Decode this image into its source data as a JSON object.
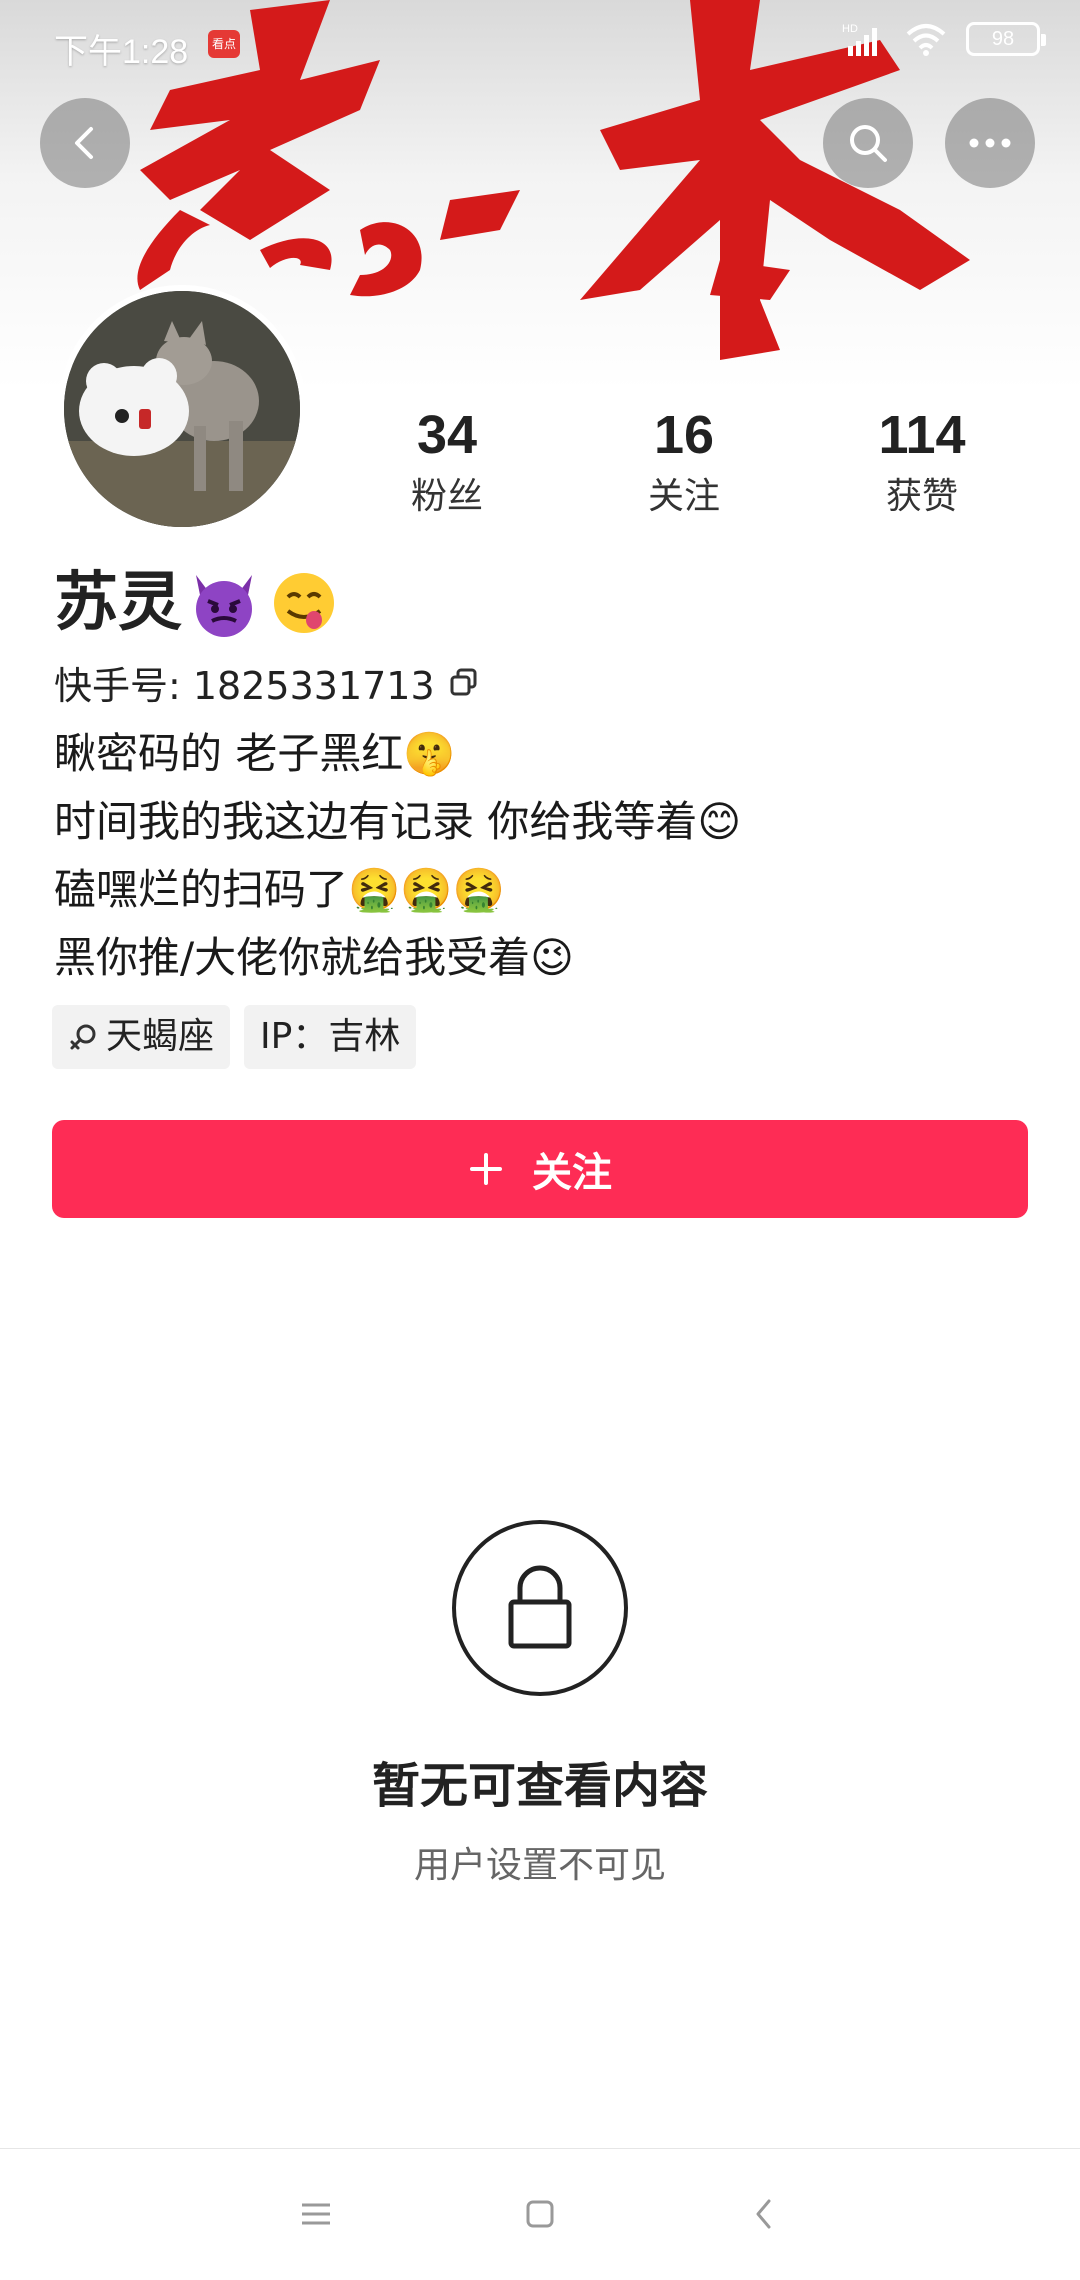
{
  "status_bar": {
    "time": "下午1:28",
    "app_badge": "看点",
    "network": "HD",
    "battery": "98"
  },
  "header": {
    "banner_text": "忘本",
    "back_icon": "chevron-left-icon",
    "search_icon": "search-icon",
    "more_icon": "more-dots-icon"
  },
  "profile": {
    "name": "苏灵",
    "name_emojis": [
      "😈",
      "😋"
    ],
    "id_label": "快手号: 1825331713",
    "stats": [
      {
        "value": "34",
        "label": "粉丝"
      },
      {
        "value": "16",
        "label": "关注"
      },
      {
        "value": "114",
        "label": "获赞"
      }
    ],
    "bio": [
      {
        "text": "瞅密码的 老子黑红",
        "emoji": "🤫"
      },
      {
        "text": "时间我的我这边有记录 你给我等着",
        "emoji": "😊"
      },
      {
        "text": "磕嘿烂的扫码了",
        "emoji": "🤮🤮🤮"
      },
      {
        "text": "黑你推/大佬你就给我受着",
        "emoji": "😉"
      }
    ],
    "tags": [
      {
        "icon": "female-symbol-icon",
        "label": "天蝎座"
      },
      {
        "label": "IP：吉林"
      }
    ],
    "follow_button": "关注"
  },
  "empty_state": {
    "title": "暂无可查看内容",
    "subtitle": "用户设置不可见"
  },
  "nav_bar": {
    "items": [
      "menu-icon",
      "home-icon",
      "back-icon"
    ]
  },
  "colors": {
    "accent": "#fe2c55",
    "banner_red": "#d81b1b"
  }
}
